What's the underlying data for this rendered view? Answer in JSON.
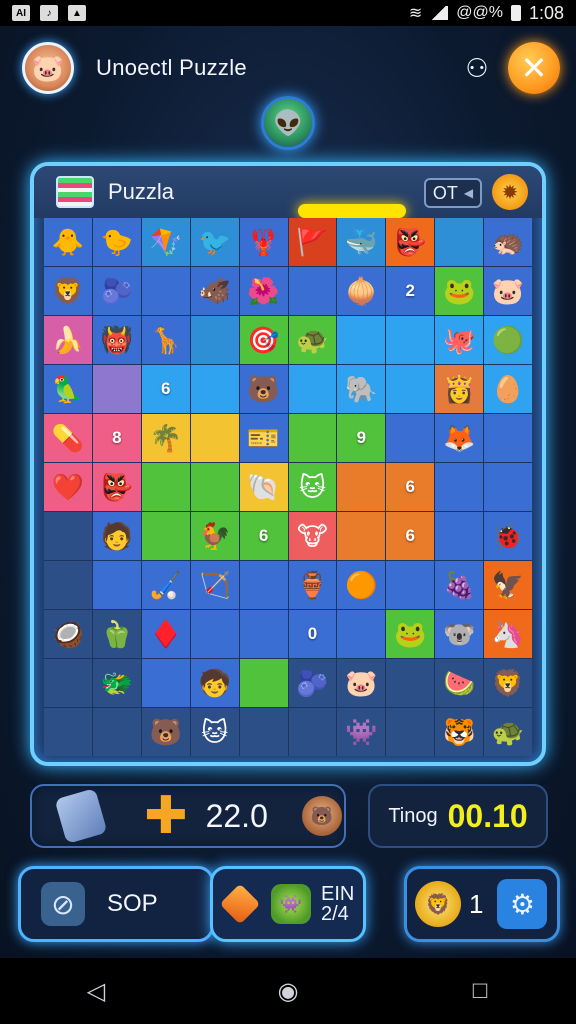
{
  "status": {
    "time": "1:08",
    "battery": "@@%",
    "icons": [
      "app-icon-a",
      "music-icon",
      "photo-icon"
    ]
  },
  "header": {
    "title": "Unoectl Puzzle",
    "close_glyph": "✕",
    "share_glyph": "⚇"
  },
  "board": {
    "label": "Puzzla",
    "hint_text": "OT",
    "cells": [
      {
        "bg": "#3a6ed3",
        "icon": "🐥"
      },
      {
        "bg": "#3a6ed3",
        "icon": "🐤"
      },
      {
        "bg": "#2f8fd6",
        "icon": "🪁"
      },
      {
        "bg": "#2f8fd6",
        "icon": "🐦"
      },
      {
        "bg": "#3a6ed3",
        "icon": "🦞"
      },
      {
        "bg": "#d9401e",
        "icon": "🚩"
      },
      {
        "bg": "#2f8fd6",
        "icon": "🐳"
      },
      {
        "bg": "#f06a1c",
        "icon": "👺"
      },
      {
        "bg": "#2f8fd6",
        "icon": ""
      },
      {
        "bg": "#3a6ed3",
        "icon": "🦔"
      },
      {
        "bg": "#3a6ed3",
        "icon": "🦁"
      },
      {
        "bg": "#3a6ed3",
        "icon": "🫐"
      },
      {
        "bg": "#3a6ed3",
        "icon": ""
      },
      {
        "bg": "#3a6ed3",
        "icon": "🐗"
      },
      {
        "bg": "#3a6ed3",
        "icon": "🌺"
      },
      {
        "bg": "#3a6ed3",
        "icon": ""
      },
      {
        "bg": "#3a6ed3",
        "icon": "🧅"
      },
      {
        "bg": "#3a6ed3",
        "num": "2"
      },
      {
        "bg": "#51c23b",
        "icon": "🐸"
      },
      {
        "bg": "#3a6ed3",
        "icon": "🐷"
      },
      {
        "bg": "#d75fa8",
        "icon": "🍌"
      },
      {
        "bg": "#3a6ed3",
        "icon": "👹"
      },
      {
        "bg": "#3a6ed3",
        "icon": "🦒"
      },
      {
        "bg": "#2f8fd6",
        "icon": ""
      },
      {
        "bg": "#51c23b",
        "icon": "🎯"
      },
      {
        "bg": "#51c23b",
        "icon": "🐢"
      },
      {
        "bg": "#2fa3f0",
        "icon": ""
      },
      {
        "bg": "#2fa3f0",
        "icon": ""
      },
      {
        "bg": "#2fa3f0",
        "icon": "🐙"
      },
      {
        "bg": "#2fa3f0",
        "icon": "🟢"
      },
      {
        "bg": "#3a6ed3",
        "icon": "🦜"
      },
      {
        "bg": "#8e78cf",
        "icon": ""
      },
      {
        "bg": "#2fa3f0",
        "num": "6"
      },
      {
        "bg": "#2fa3f0",
        "icon": ""
      },
      {
        "bg": "#3a6ed3",
        "icon": "🐻"
      },
      {
        "bg": "#2fa3f0",
        "icon": ""
      },
      {
        "bg": "#2fa3f0",
        "icon": "🐘"
      },
      {
        "bg": "#2fa3f0",
        "icon": ""
      },
      {
        "bg": "#e47a3b",
        "icon": "👸"
      },
      {
        "bg": "#2fa3f0",
        "icon": "🥚"
      },
      {
        "bg": "#ef5e86",
        "icon": "💊"
      },
      {
        "bg": "#ef5e86",
        "num": "8"
      },
      {
        "bg": "#f3c332",
        "icon": "🌴"
      },
      {
        "bg": "#f3c332",
        "icon": ""
      },
      {
        "bg": "#3a6ed3",
        "icon": "🎫"
      },
      {
        "bg": "#51c23b",
        "icon": ""
      },
      {
        "bg": "#51c23b",
        "num": "9"
      },
      {
        "bg": "#3a6ed3",
        "icon": ""
      },
      {
        "bg": "#3a6ed3",
        "icon": "🦊"
      },
      {
        "bg": "#3a6ed3",
        "icon": ""
      },
      {
        "bg": "#ef5e86",
        "icon": "❤️"
      },
      {
        "bg": "#ef5e86",
        "icon": "👺"
      },
      {
        "bg": "#51c23b",
        "icon": ""
      },
      {
        "bg": "#51c23b",
        "icon": ""
      },
      {
        "bg": "#f3c332",
        "icon": "🐚"
      },
      {
        "bg": "#51c23b",
        "icon": "🐱"
      },
      {
        "bg": "#e97c2b",
        "icon": ""
      },
      {
        "bg": "#e97c2b",
        "num": "6"
      },
      {
        "bg": "#3a6ed3",
        "icon": ""
      },
      {
        "bg": "#3a6ed3",
        "icon": ""
      },
      {
        "bg": "#2b4f86",
        "icon": ""
      },
      {
        "bg": "#3a6ed3",
        "icon": "🧑"
      },
      {
        "bg": "#51c23b",
        "icon": ""
      },
      {
        "bg": "#51c23b",
        "icon": "🐓"
      },
      {
        "bg": "#51c23b",
        "num": "6"
      },
      {
        "bg": "#ef5e5e",
        "icon": "🐮"
      },
      {
        "bg": "#e97c2b",
        "icon": ""
      },
      {
        "bg": "#e97c2b",
        "num": "6"
      },
      {
        "bg": "#3a6ed3",
        "icon": ""
      },
      {
        "bg": "#3a6ed3",
        "icon": "🐞"
      },
      {
        "bg": "#2b4f86",
        "icon": ""
      },
      {
        "bg": "#3a6ed3",
        "icon": ""
      },
      {
        "bg": "#3a6ed3",
        "icon": "🏑"
      },
      {
        "bg": "#3a6ed3",
        "icon": "🏹"
      },
      {
        "bg": "#3a6ed3",
        "icon": ""
      },
      {
        "bg": "#3a6ed3",
        "icon": "🏺"
      },
      {
        "bg": "#3a6ed3",
        "icon": "🟠"
      },
      {
        "bg": "#3a6ed3",
        "icon": ""
      },
      {
        "bg": "#3a6ed3",
        "icon": "🍇"
      },
      {
        "bg": "#f06a1c",
        "icon": "🦅"
      },
      {
        "bg": "#2b4f86",
        "icon": "🥥"
      },
      {
        "bg": "#2b4f86",
        "icon": "🫑"
      },
      {
        "bg": "#3a6ed3",
        "icon": "♦️"
      },
      {
        "bg": "#3a6ed3",
        "icon": ""
      },
      {
        "bg": "#3a6ed3",
        "icon": ""
      },
      {
        "bg": "#3a6ed3",
        "num": "0"
      },
      {
        "bg": "#3a6ed3",
        "icon": ""
      },
      {
        "bg": "#51c23b",
        "icon": "🐸"
      },
      {
        "bg": "#3a6ed3",
        "icon": "🐨"
      },
      {
        "bg": "#f06a1c",
        "icon": "🦄"
      },
      {
        "bg": "#2b4f86",
        "icon": ""
      },
      {
        "bg": "#2b4f86",
        "icon": "🐲"
      },
      {
        "bg": "#3a6ed3",
        "icon": ""
      },
      {
        "bg": "#3a6ed3",
        "icon": "🧒"
      },
      {
        "bg": "#51c23b",
        "icon": ""
      },
      {
        "bg": "#2b4f86",
        "icon": "🫐"
      },
      {
        "bg": "#2b4f86",
        "icon": "🐷"
      },
      {
        "bg": "#2b4f86",
        "icon": ""
      },
      {
        "bg": "#2b4f86",
        "icon": "🍉"
      },
      {
        "bg": "#2b4f86",
        "icon": "🦁"
      },
      {
        "bg": "#2b4f86",
        "icon": ""
      },
      {
        "bg": "#2b4f86",
        "icon": ""
      },
      {
        "bg": "#2b4f86",
        "icon": "🐻"
      },
      {
        "bg": "#2b4f86",
        "icon": "🐱"
      },
      {
        "bg": "#2b4f86",
        "icon": ""
      },
      {
        "bg": "#2b4f86",
        "icon": ""
      },
      {
        "bg": "#2b4f86",
        "icon": "👾"
      },
      {
        "bg": "#2b4f86",
        "icon": ""
      },
      {
        "bg": "#2b4f86",
        "icon": "🐯"
      },
      {
        "bg": "#2b4f86",
        "icon": "🐢"
      }
    ]
  },
  "score": {
    "value": "22.0",
    "plus_glyph": "✚"
  },
  "timer": {
    "label": "Tinog",
    "value": "00.10"
  },
  "controls": {
    "stop_label": "SOP",
    "power_line1": "EIN",
    "power_line2": "2/4",
    "lives": "1"
  },
  "colors": {
    "accent_glow": "#6fd0ff",
    "progress": "#ffe400",
    "timer_text": "#f3ef1c",
    "close_button": "#ff9a1f"
  }
}
